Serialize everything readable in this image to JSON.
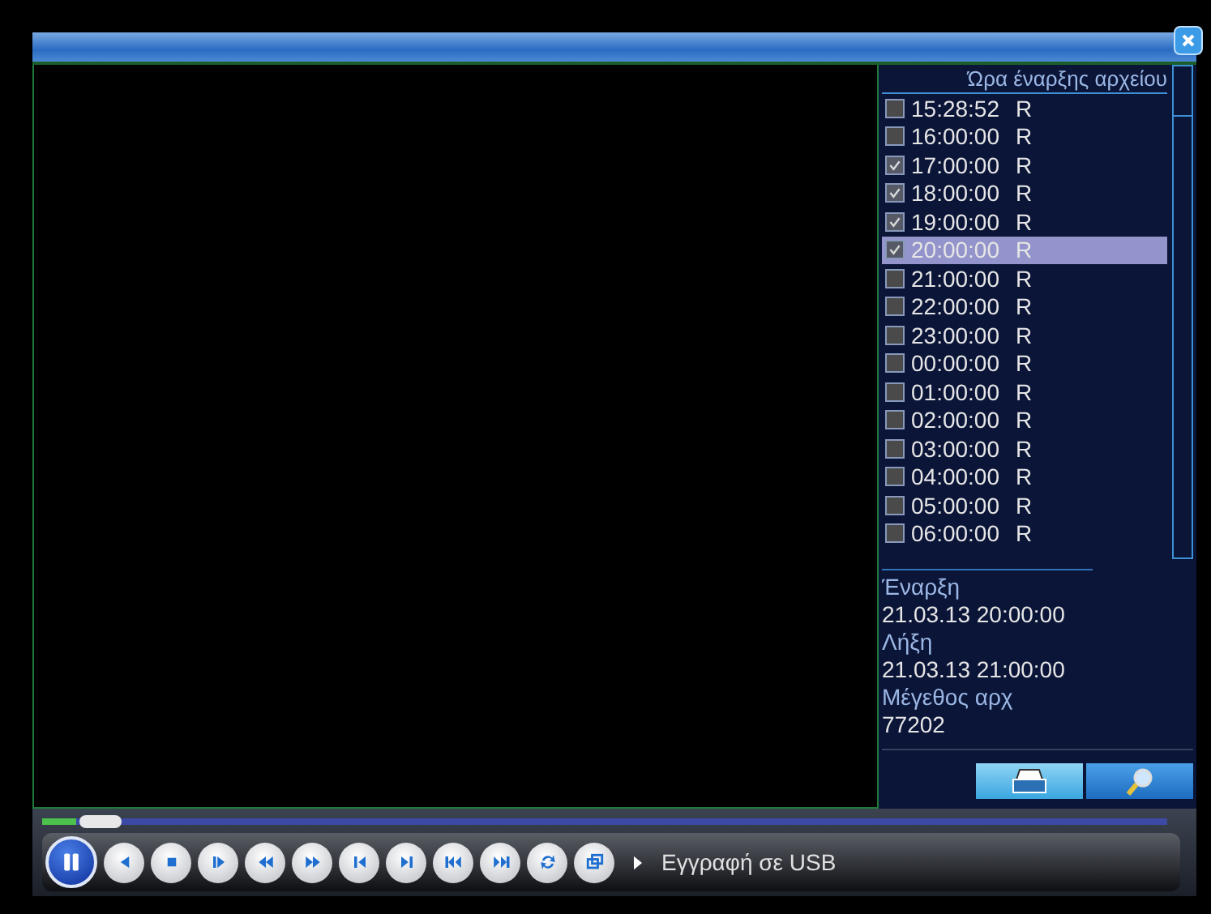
{
  "file_list": {
    "header": "Ώρα έναρξης αρχείου",
    "items": [
      {
        "time": "15:28:52",
        "type": "R",
        "checked": false,
        "selected": false
      },
      {
        "time": "16:00:00",
        "type": "R",
        "checked": false,
        "selected": false
      },
      {
        "time": "17:00:00",
        "type": "R",
        "checked": true,
        "selected": false
      },
      {
        "time": "18:00:00",
        "type": "R",
        "checked": true,
        "selected": false
      },
      {
        "time": "19:00:00",
        "type": "R",
        "checked": true,
        "selected": false
      },
      {
        "time": "20:00:00",
        "type": "R",
        "checked": true,
        "selected": true
      },
      {
        "time": "21:00:00",
        "type": "R",
        "checked": false,
        "selected": false
      },
      {
        "time": "22:00:00",
        "type": "R",
        "checked": false,
        "selected": false
      },
      {
        "time": "23:00:00",
        "type": "R",
        "checked": false,
        "selected": false
      },
      {
        "time": "00:00:00",
        "type": "R",
        "checked": false,
        "selected": false
      },
      {
        "time": "01:00:00",
        "type": "R",
        "checked": false,
        "selected": false
      },
      {
        "time": "02:00:00",
        "type": "R",
        "checked": false,
        "selected": false
      },
      {
        "time": "03:00:00",
        "type": "R",
        "checked": false,
        "selected": false
      },
      {
        "time": "04:00:00",
        "type": "R",
        "checked": false,
        "selected": false
      },
      {
        "time": "05:00:00",
        "type": "R",
        "checked": false,
        "selected": false
      },
      {
        "time": "06:00:00",
        "type": "R",
        "checked": false,
        "selected": false
      }
    ]
  },
  "file_info": [
    {
      "label": "Έναρξη",
      "value": "21.03.13 20:00:00"
    },
    {
      "label": "Λήξη",
      "value": "21.03.13 21:00:00"
    },
    {
      "label": "Μέγεθος αρχ",
      "value": "77202"
    }
  ],
  "action_buttons": [
    {
      "kind": "backup"
    },
    {
      "kind": "search"
    }
  ],
  "playback": {
    "level": 0.03
  },
  "controls": [
    {
      "kind": "pause"
    },
    {
      "kind": "reverse"
    },
    {
      "kind": "stop"
    },
    {
      "kind": "play"
    },
    {
      "kind": "rewind"
    },
    {
      "kind": "fast_forward"
    },
    {
      "kind": "prev_frame"
    },
    {
      "kind": "next_frame"
    },
    {
      "kind": "first"
    },
    {
      "kind": "last"
    },
    {
      "kind": "repeat"
    },
    {
      "kind": "window"
    }
  ],
  "status": "Εγγραφή σε USB"
}
